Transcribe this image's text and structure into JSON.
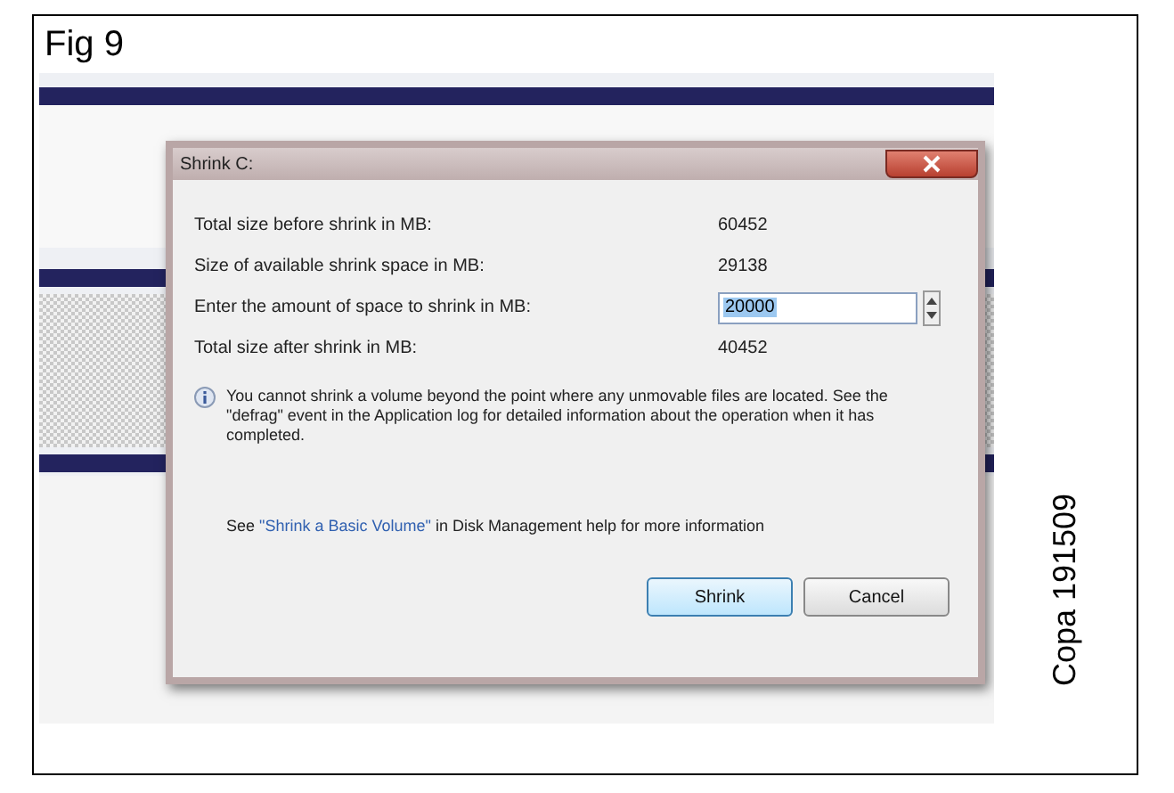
{
  "figure": {
    "label": "Fig 9",
    "credit": "Copa 191509"
  },
  "dialog": {
    "title": "Shrink C:",
    "fields": [
      {
        "kind": "readout",
        "label": "Total size before shrink in MB:",
        "value": "60452"
      },
      {
        "kind": "readout",
        "label": "Size of available shrink space in MB:",
        "value": "29138"
      },
      {
        "kind": "input",
        "label": "Enter the amount of space to shrink in MB:",
        "value": "20000"
      },
      {
        "kind": "readout",
        "label": "Total size after shrink in MB:",
        "value": "40452"
      }
    ],
    "note": "You cannot shrink a volume beyond the point where any unmovable files are located. See the \"defrag\" event in the Application log for detailed information about the operation when it has completed.",
    "help": {
      "before": "See",
      "link": "\"Shrink a Basic Volume\"",
      "after": "in Disk Management help for more information"
    },
    "buttons": [
      {
        "label": "Shrink",
        "selected": true
      },
      {
        "label": "Cancel",
        "selected": false
      }
    ]
  }
}
